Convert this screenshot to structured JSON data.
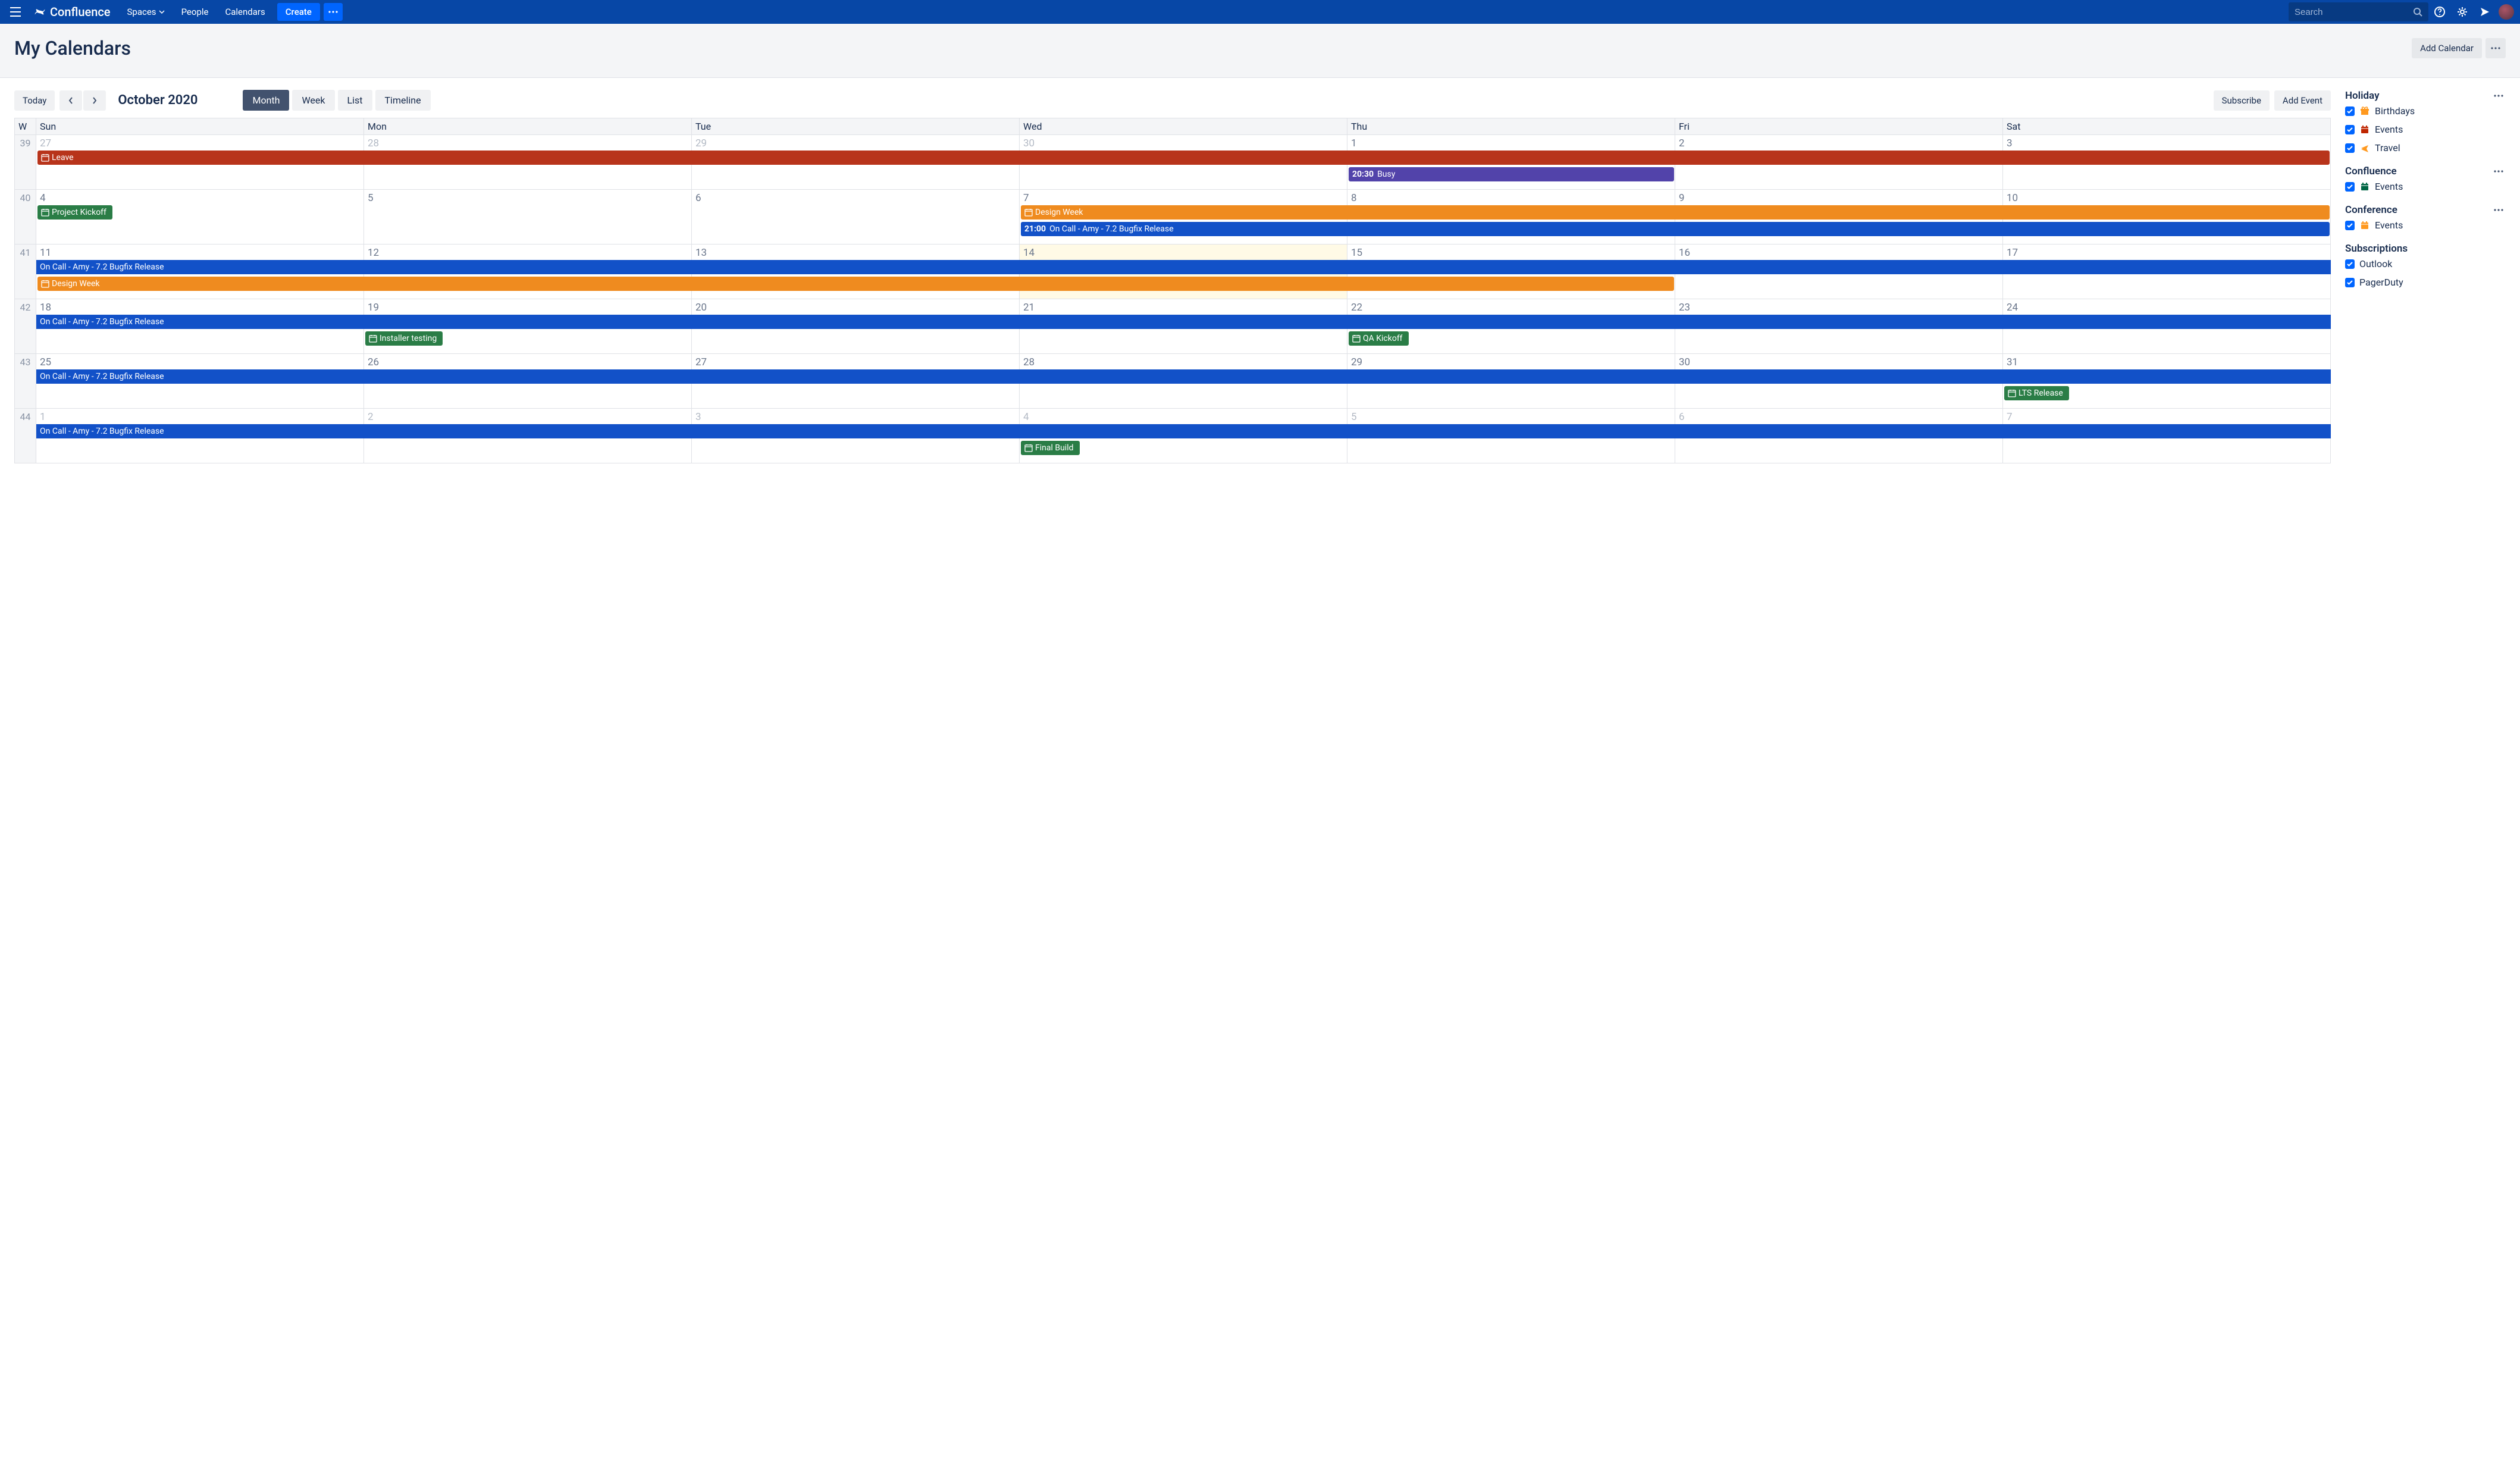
{
  "nav": {
    "brand": "Confluence",
    "items": [
      "Spaces",
      "People",
      "Calendars"
    ],
    "create": "Create",
    "search_placeholder": "Search"
  },
  "header": {
    "title": "My Calendars",
    "add_button": "Add Calendar"
  },
  "toolbar": {
    "today": "Today",
    "month_label": "October 2020",
    "views": [
      "Month",
      "Week",
      "List",
      "Timeline"
    ],
    "active_view": "Month",
    "subscribe": "Subscribe",
    "add_event": "Add Event"
  },
  "calendar": {
    "day_headers": [
      "W",
      "Sun",
      "Mon",
      "Tue",
      "Wed",
      "Thu",
      "Fri",
      "Sat"
    ],
    "weeks": [
      {
        "num": "39",
        "days": [
          {
            "n": "27",
            "o": true
          },
          {
            "n": "28",
            "o": true
          },
          {
            "n": "29",
            "o": true
          },
          {
            "n": "30",
            "o": true
          },
          {
            "n": "1"
          },
          {
            "n": "2"
          },
          {
            "n": "3"
          }
        ],
        "events": [
          {
            "label": "Leave",
            "color": "c-red",
            "start": 0,
            "span": 7,
            "row": 0,
            "icon": true
          },
          {
            "time": "20:30",
            "label": "Busy",
            "color": "c-purple",
            "start": 4,
            "span": 1,
            "row": 1
          }
        ]
      },
      {
        "num": "40",
        "days": [
          {
            "n": "4"
          },
          {
            "n": "5"
          },
          {
            "n": "6"
          },
          {
            "n": "7"
          },
          {
            "n": "8"
          },
          {
            "n": "9"
          },
          {
            "n": "10"
          }
        ],
        "events": [
          {
            "label": "Project Kickoff",
            "color": "c-green",
            "start": 0,
            "span": 1,
            "row": 0,
            "icon": true,
            "short": true
          },
          {
            "label": "Design Week",
            "color": "c-orange",
            "start": 3,
            "span": 4,
            "row": 0,
            "icon": true
          },
          {
            "time": "21:00",
            "label": "On Call - Amy - 7.2 Bugfix Release",
            "color": "c-blue",
            "start": 3,
            "span": 4,
            "row": 1
          }
        ]
      },
      {
        "num": "41",
        "days": [
          {
            "n": "11"
          },
          {
            "n": "12"
          },
          {
            "n": "13"
          },
          {
            "n": "14",
            "today": true
          },
          {
            "n": "15"
          },
          {
            "n": "16"
          },
          {
            "n": "17"
          }
        ],
        "events": [
          {
            "label": "On Call - Amy - 7.2 Bugfix Release",
            "color": "c-blue",
            "start": 0,
            "span": 7,
            "row": 0,
            "flat": true
          },
          {
            "label": "Design Week",
            "color": "c-orange",
            "start": 0,
            "span": 5,
            "row": 1,
            "icon": true
          }
        ]
      },
      {
        "num": "42",
        "days": [
          {
            "n": "18"
          },
          {
            "n": "19"
          },
          {
            "n": "20"
          },
          {
            "n": "21"
          },
          {
            "n": "22"
          },
          {
            "n": "23"
          },
          {
            "n": "24"
          }
        ],
        "events": [
          {
            "label": "On Call - Amy - 7.2 Bugfix Release",
            "color": "c-blue",
            "start": 0,
            "span": 7,
            "row": 0,
            "flat": true
          },
          {
            "label": "Installer testing",
            "color": "c-green",
            "start": 1,
            "span": 1,
            "row": 1,
            "icon": true,
            "short": true
          },
          {
            "label": "QA Kickoff",
            "color": "c-green",
            "start": 4,
            "span": 1,
            "row": 1,
            "icon": true,
            "short": true
          }
        ]
      },
      {
        "num": "43",
        "days": [
          {
            "n": "25"
          },
          {
            "n": "26"
          },
          {
            "n": "27"
          },
          {
            "n": "28"
          },
          {
            "n": "29"
          },
          {
            "n": "30"
          },
          {
            "n": "31"
          }
        ],
        "events": [
          {
            "label": "On Call - Amy - 7.2 Bugfix Release",
            "color": "c-blue",
            "start": 0,
            "span": 7,
            "row": 0,
            "flat": true
          },
          {
            "label": "LTS Release",
            "color": "c-green",
            "start": 6,
            "span": 1,
            "row": 1,
            "icon": true,
            "short": true
          }
        ]
      },
      {
        "num": "44",
        "days": [
          {
            "n": "1",
            "o": true
          },
          {
            "n": "2",
            "o": true
          },
          {
            "n": "3",
            "o": true
          },
          {
            "n": "4",
            "o": true
          },
          {
            "n": "5",
            "o": true
          },
          {
            "n": "6",
            "o": true
          },
          {
            "n": "7",
            "o": true
          }
        ],
        "events": [
          {
            "label": "On Call - Amy - 7.2 Bugfix Release",
            "color": "c-blue",
            "start": 0,
            "span": 7,
            "row": 0,
            "flat": true
          },
          {
            "label": "Final Build",
            "color": "c-green",
            "start": 3,
            "span": 1,
            "row": 1,
            "icon": true,
            "short": true
          }
        ]
      }
    ]
  },
  "sidebar": {
    "groups": [
      {
        "title": "Holiday",
        "menu": true,
        "items": [
          {
            "label": "Birthdays",
            "icon": "gift",
            "icon_color": "#ff991f"
          },
          {
            "label": "Events",
            "icon": "calendar",
            "icon_color": "#bf2600"
          },
          {
            "label": "Travel",
            "icon": "plane",
            "icon_color": "#ff991f"
          }
        ]
      },
      {
        "title": "Confluence",
        "menu": true,
        "items": [
          {
            "label": "Events",
            "icon": "calendar",
            "icon_color": "#006644"
          }
        ]
      },
      {
        "title": "Conference",
        "menu": true,
        "items": [
          {
            "label": "Events",
            "icon": "calendar",
            "icon_color": "#ff991f"
          }
        ]
      },
      {
        "title": "Subscriptions",
        "menu": false,
        "items": [
          {
            "label": "Outlook"
          },
          {
            "label": "PagerDuty"
          }
        ]
      }
    ]
  }
}
